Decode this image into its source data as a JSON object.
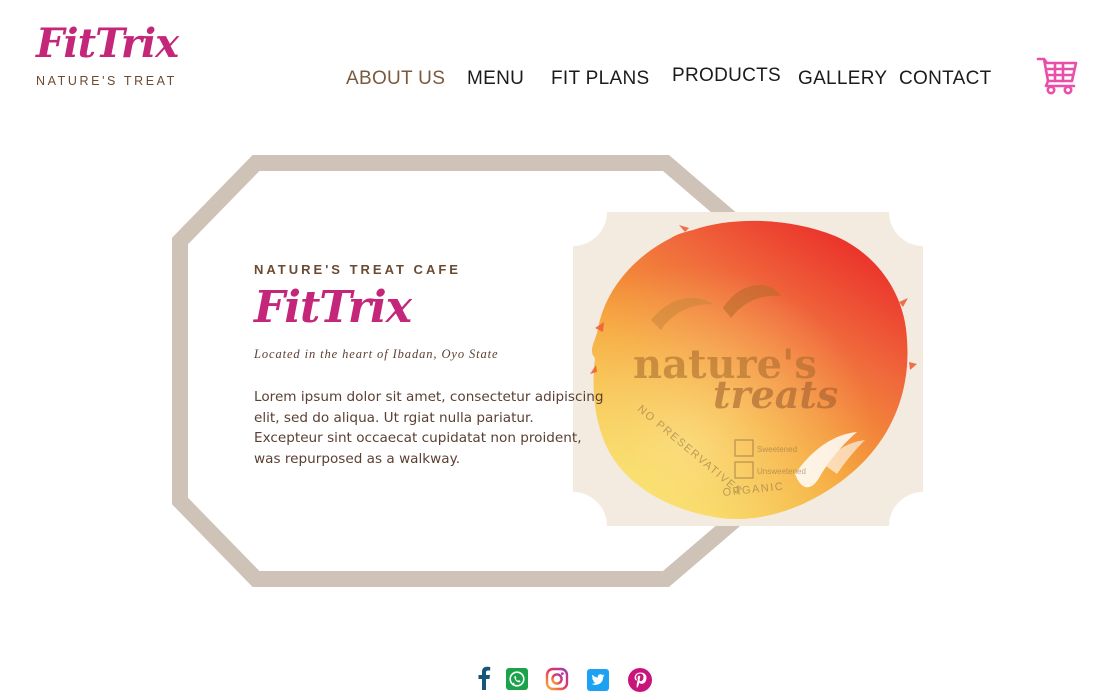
{
  "brand": {
    "logo_text": "FitTrix",
    "logo_tagline": "NATURE'S TREAT"
  },
  "nav": {
    "items": [
      {
        "label": "ABOUT US",
        "active": true
      },
      {
        "label": "MENU"
      },
      {
        "label": "FIT PLANS"
      },
      {
        "label": "PRODUCTS"
      },
      {
        "label": "GALLERY"
      },
      {
        "label": "CONTACT"
      }
    ],
    "cart_icon": "shopping-cart-icon"
  },
  "hero": {
    "eyebrow": "NATURE'S TREAT CAFE",
    "title": "FitTrix",
    "location": "Located in the heart of Ibadan, Oyo State",
    "body": "Lorem ipsum dolor sit amet, consectetur adipiscing elit, sed do  aliqua. Ut  rgiat nulla pariatur. Excepteur sint occaecat cupidatat non proident, was repurposed as a walkway.",
    "image": {
      "brand_text": "nature's",
      "brand_text_2": "treats",
      "ring_text_1": "NO PRESERVATIVES",
      "ring_text_2": "ORGANIC",
      "option_1": "Sweetened",
      "option_2": "Unsweetened"
    }
  },
  "social": [
    {
      "name": "facebook-icon"
    },
    {
      "name": "whatsapp-icon"
    },
    {
      "name": "instagram-icon"
    },
    {
      "name": "twitter-icon"
    },
    {
      "name": "pinterest-icon"
    }
  ],
  "colors": {
    "brand_pink": "#c4267a",
    "brown_text": "#6b4a32",
    "frame_taupe": "#cfc2b6",
    "card_beige": "#f3ebdf",
    "cart_pink": "#e94fa9",
    "facebook": "#16567a",
    "whatsapp": "#1aa34a",
    "twitter": "#1da1f2",
    "pinterest": "#c9157a"
  }
}
